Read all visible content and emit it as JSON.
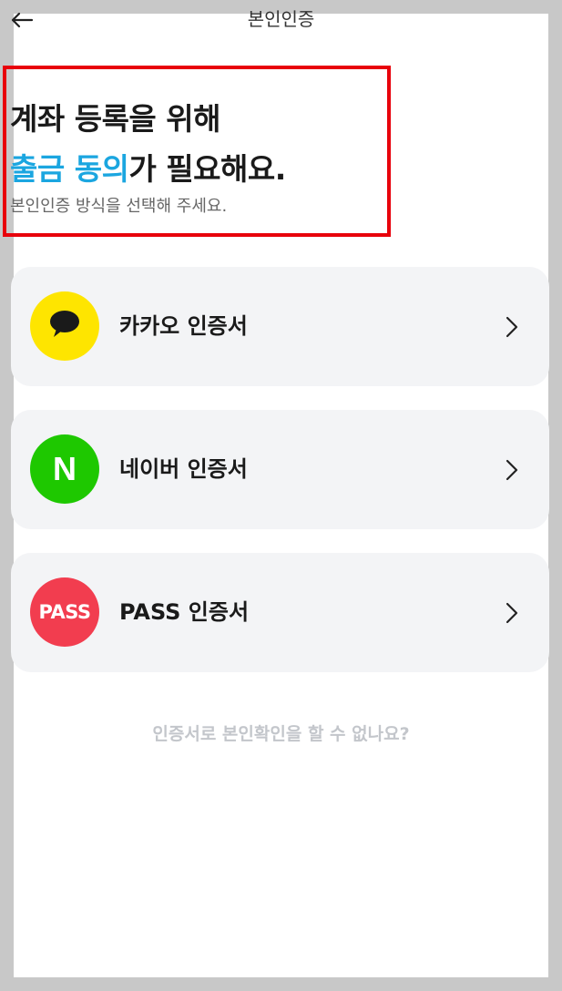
{
  "header": {
    "title": "본인인증",
    "back_icon": "arrow-left-icon"
  },
  "headline": {
    "line1": "계좌 등록을 위해",
    "line2_accent": "출금 동의",
    "line2_rest": "가 필요해요.",
    "subtitle": "본인인증 방식을 선택해 주세요."
  },
  "options": [
    {
      "label": "카카오 인증서",
      "icon": "kakao-chat-bubble-icon",
      "color": "#fee500"
    },
    {
      "label": "네이버 인증서",
      "logo_text": "N",
      "color": "#1ec800"
    },
    {
      "label": "PASS 인증서",
      "logo_text": "PASS",
      "color": "#f23d4f"
    }
  ],
  "help_link": "인증서로 본인확인을 할 수 없나요?",
  "colors": {
    "accent": "#1ba6e0",
    "highlight_border": "#e8000b",
    "card_bg": "#f3f4f6"
  }
}
